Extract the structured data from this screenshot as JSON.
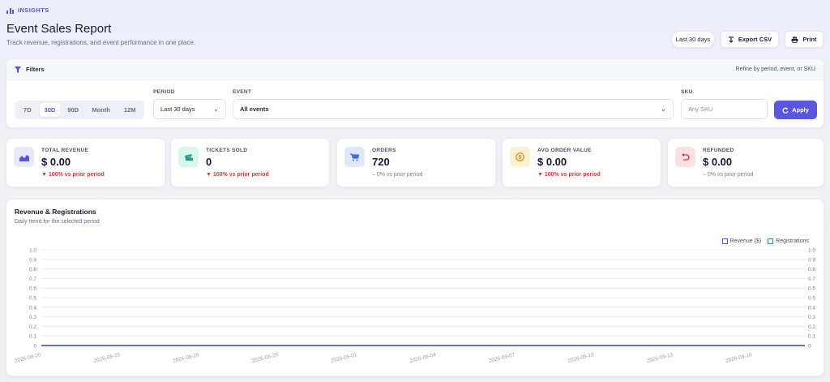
{
  "header": {
    "brand": "INSIGHTS",
    "title": "Event Sales Report",
    "subtitle": "Track revenue, registrations, and event performance in one place.",
    "range_pill": "Last 30 days",
    "export_label": "Export CSV",
    "print_label": "Print"
  },
  "filters": {
    "title": "Filters",
    "hint": "Refine by period, event, or SKU",
    "quick_ranges": [
      "7D",
      "30D",
      "90D",
      "Month",
      "12M"
    ],
    "active_range": "30D",
    "period_label": "PERIOD",
    "period_value": "Last 30 days",
    "event_label": "EVENT",
    "event_value": "All events",
    "sku_label": "SKU",
    "sku_placeholder": "Any SKU",
    "apply_label": "Apply"
  },
  "kpis": [
    {
      "label": "TOTAL REVENUE",
      "value": "$ 0.00",
      "delta": "▼ 100% vs prior period",
      "trend": "down",
      "icon": "area-chart-icon",
      "color": "#5a55d8",
      "bg": "#e8e9fb"
    },
    {
      "label": "TICKETS SOLD",
      "value": "0",
      "delta": "▼ 100% vs prior period",
      "trend": "down",
      "icon": "ticket-icon",
      "color": "#1f9e80",
      "bg": "#d6f6ee"
    },
    {
      "label": "ORDERS",
      "value": "720",
      "delta": "– 0% vs prior period",
      "trend": "flat",
      "icon": "cart-icon",
      "color": "#3b6fd8",
      "bg": "#dfe8fb"
    },
    {
      "label": "AVG ORDER VALUE",
      "value": "$ 0.00",
      "delta": "▼ 100% vs prior period",
      "trend": "down",
      "icon": "dollar-coin-icon",
      "color": "#c58a12",
      "bg": "#fbf0cf"
    },
    {
      "label": "REFUNDED",
      "value": "$ 0.00",
      "delta": "– 0% vs prior period",
      "trend": "flat",
      "icon": "undo-icon",
      "color": "#d13b3b",
      "bg": "#fbe1e3"
    }
  ],
  "chart": {
    "title": "Revenue & Registrations",
    "subtitle": "Daily trend for the selected period"
  },
  "chart_data": {
    "type": "line",
    "x": [
      "2026-08-20",
      "2026-08-21",
      "2026-08-22",
      "2026-08-23",
      "2026-08-24",
      "2026-08-25",
      "2026-08-26",
      "2026-08-27",
      "2026-08-28",
      "2026-08-29",
      "2026-08-30",
      "2026-08-31",
      "2026-09-01",
      "2026-09-02",
      "2026-09-03",
      "2026-09-04",
      "2026-09-05",
      "2026-09-06",
      "2026-09-07",
      "2026-09-08",
      "2026-09-09",
      "2026-09-10",
      "2026-09-11",
      "2026-09-12",
      "2026-09-13",
      "2026-09-14",
      "2026-09-15",
      "2026-09-16",
      "2026-09-17",
      "2026-09-18"
    ],
    "x_tick_labels": [
      "2026-08-20",
      "2026-08-23",
      "2026-08-26",
      "2026-08-29",
      "2026-09-01",
      "2026-09-04",
      "2026-09-07",
      "2026-09-10",
      "2026-09-13",
      "2026-09-16"
    ],
    "series": [
      {
        "name": "Revenue ($)",
        "color": "#5a55d8",
        "axis": "left",
        "values": [
          0,
          0,
          0,
          0,
          0,
          0,
          0,
          0,
          0,
          0,
          0,
          0,
          0,
          0,
          0,
          0,
          0,
          0,
          0,
          0,
          0,
          0,
          0,
          0,
          0,
          0,
          0,
          0,
          0,
          0
        ]
      },
      {
        "name": "Registrations",
        "color": "#1f9e80",
        "axis": "right",
        "values": [
          0,
          0,
          0,
          0,
          0,
          0,
          0,
          0,
          0,
          0,
          0,
          0,
          0,
          0,
          0,
          0,
          0,
          0,
          0,
          0,
          0,
          0,
          0,
          0,
          0,
          0,
          0,
          0,
          0,
          0
        ]
      }
    ],
    "y_ticks": [
      "0",
      "0.1",
      "0.2",
      "0.3",
      "0.4",
      "0.5",
      "0.6",
      "0.7",
      "0.8",
      "0.9",
      "1.0"
    ],
    "ylim": [
      0,
      1
    ],
    "y2lim": [
      0,
      1
    ],
    "grid": true,
    "legend": "top-right"
  }
}
